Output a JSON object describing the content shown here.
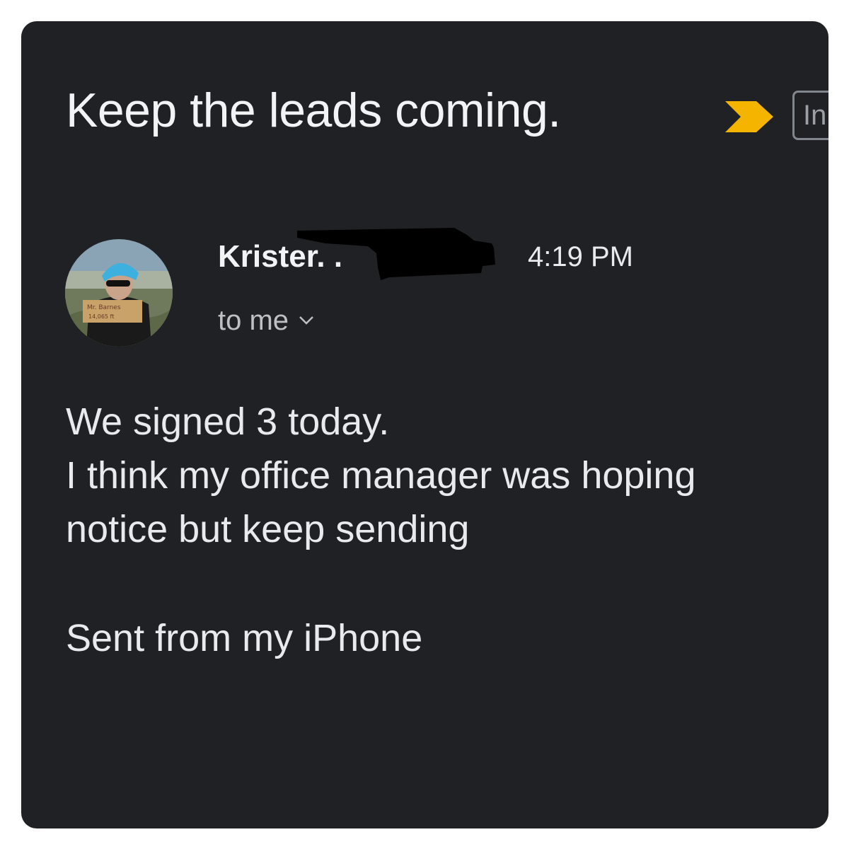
{
  "email": {
    "subject": "Keep the leads coming.",
    "label_chip": "In",
    "importance_marker_color": "#f4b400",
    "sender_name": "Krister. .",
    "time": "4:19 PM",
    "recipient": "to me",
    "body_lines": [
      "We signed 3 today.",
      "I think my office manager was hoping",
      "notice but keep sending"
    ],
    "signature": "Sent from my iPhone",
    "avatar_sign_text": [
      "Mr. Barnes",
      "14,065 ft"
    ],
    "icons": {
      "importance": "importance-marker-icon",
      "recipient_details": "chevron-down-icon"
    }
  }
}
